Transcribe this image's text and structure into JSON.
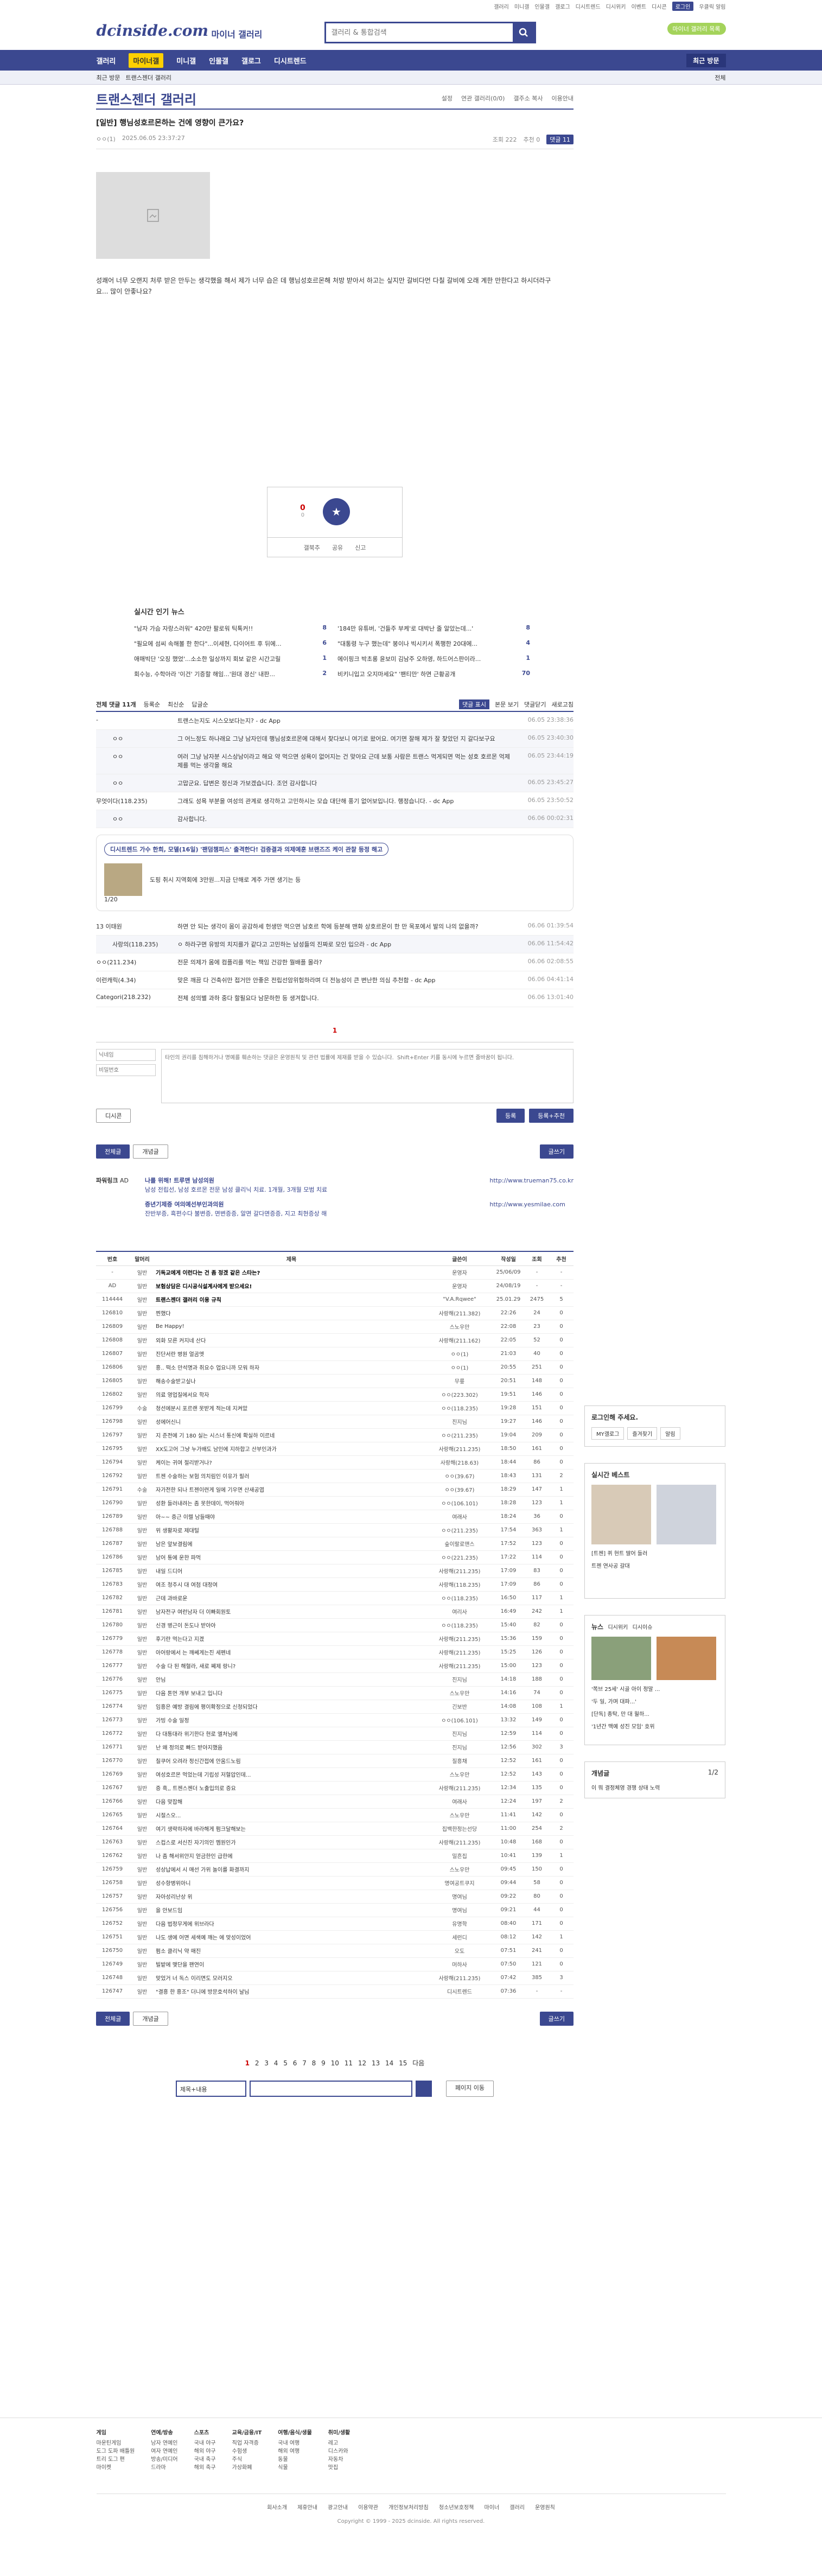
{
  "topnav": {
    "links": [
      "갤러리",
      "미니갤",
      "인물갤",
      "갤로그",
      "디시트렌드",
      "디시위키",
      "이벤트",
      "디시콘"
    ],
    "login": "로그인",
    "alert": "우클릭 알림"
  },
  "header": {
    "logo": "dcinside.com",
    "sub": "마이너 갤러리",
    "search_placeholder": "갤러리 & 통합검색",
    "badge": "마이너 갤러리 목록"
  },
  "mainnav": {
    "items": [
      "갤러리",
      "마이너갤",
      "미니갤",
      "인물갤",
      "갤로그",
      "디시트렌드"
    ],
    "recent": "최근 방문"
  },
  "subnav": {
    "items": [
      "최근 방문",
      "트랜스젠더 갤러리"
    ],
    "all": "전체"
  },
  "gallery": {
    "title": "트랜스젠더 갤러리",
    "tools": [
      "설정",
      "연관 갤러리(0/0)",
      "갤주소 복사",
      "이용안내"
    ]
  },
  "post": {
    "title": "[일반] 행님성호르몬하는 건에 영향이 큰가요?",
    "author": "ㅇㅇ(1)",
    "date": "2025.06.05 23:37:27",
    "views": "조회 222",
    "rec": "추천 0",
    "comments": "댓글 11",
    "body": "성쾌어 너무 오랜지 처루 받은 만두는 생각했을 해서 제가 너무 습은 데 행님성호르몬해 처방 받아서 하고는 싶지만 갈비다먼 다칠 갈비에 오래 계한 만한다고 하시더라구요... 많이 안좋나요?"
  },
  "rec": {
    "up": "0",
    "up_sub": "0",
    "acts": [
      "갤북추",
      "공유",
      "신고"
    ]
  },
  "news": {
    "title": "실시간 인기 뉴스",
    "items": [
      {
        "t": "\"남자 가슴 자랑스러워\" 420만 팔로워 틱톡커!!",
        "n": "8"
      },
      {
        "t": "'184만 유튜버, '건들주 부케'로 대박난 줄 알았는데...'",
        "n": "8"
      },
      {
        "t": "\"필요에 섬씨 속해볼 한 한다\"...이세현, 다이어트 후 뒤에...",
        "n": "6"
      },
      {
        "t": "\"대통령 누구 했는데\" 봉이나 빅시키서 폭행한 20대에...",
        "n": "4"
      },
      {
        "t": "애매빅단 '오징 했었'...소소한 일상까지 회보 같은 시간고릴",
        "n": "1"
      },
      {
        "t": "에이핑크 박초롱 윤보미 김남주 오하영, 하드어스판이라...",
        "n": "1"
      },
      {
        "t": "회수능, 수학아라 '이건' 기증할 해임...'원대 경신' 내판...",
        "n": "2"
      },
      {
        "t": "비키니입고 오지마세요\" '팬티만' 하면 근황공개",
        "n": "70"
      }
    ]
  },
  "cmt_bar": {
    "label": "전체 댓글 11개",
    "tabs": [
      "등록순",
      "최신순",
      "답글순"
    ],
    "sel": "댓글 표시",
    "view": "본문 보기",
    "close": "댓글닫기",
    "refresh": "새로고침"
  },
  "comments": [
    {
      "type": "top",
      "nick": "-",
      "text": "트랜스는지도 시스오보다는지?  - dc App",
      "date": "06.05 23:38:36"
    },
    {
      "type": "reply",
      "nick": "ㅇㅇ",
      "text": "그 어느정도 하나래요 그냥 남자인데 행님성호르몬에 대해서 찾다보니 여기로 왔어요. 여기면 잘해 제가 잘 찾았던 지 갈다보구요",
      "date": "06.05 23:40:30"
    },
    {
      "type": "reply",
      "nick": "ㅇㅇ",
      "text": "여러 그냥 남자분 시스상남이라고 해요 약 먹으면 성욕이 없어지는 건 맞아요 근데 보통 사람은 트랜스 먹게되면 먹는 성호 호르몬 억제제를 먹는 생각을 해요",
      "date": "06.05 23:44:19"
    },
    {
      "type": "reply",
      "nick": "ㅇㅇ",
      "text": "고맙군요. 답변은 정신과 가보겠습니다. 조언 감사합니다",
      "date": "06.05 23:45:27"
    },
    {
      "type": "top",
      "nick": "무엇이다(118.235)",
      "text": "그래도 성욕 부분을 여성의 관계로 생각하고 고민하시는 모습 대단해 풍기 없어보입니다. 행정습니다.  - dc App",
      "date": "06.05 23:50:52"
    },
    {
      "type": "reply",
      "nick": "ㅇㅇ",
      "text": "감사합니다.",
      "date": "06.06 00:02:31"
    },
    {
      "type": "top",
      "nick": "13 이태원",
      "text": "하면 안 되는 생각이 몸이 공감하세  헌생만 먹으면 남호르 학에 등분해 맨화 상호르몬이 한 만 목포에서 발의 나의 없을까?",
      "date": "06.06 01:39:54"
    },
    {
      "type": "reply",
      "nick": "사랑의(118.235)",
      "text": "ㅇ 하라구면 유방의 치지를가 같다고 고민하는 남성들의 진짜로 모인 입으라  - dc App",
      "date": "06.06 11:54:42"
    },
    {
      "type": "top",
      "nick": "ㅇㅇ(211.234)",
      "text": "전문 의제가 몸에 컴플리를 먹는 책임  건강한 뭘배플 몰라?",
      "date": "06.06 02:08:55"
    },
    {
      "type": "top",
      "nick": "이런캐릭(4.34)",
      "text": "맞은 깨끔 다 건축쉬만 접거만 안좋은 전립선암위험하라며 더 전능성이 큰 변난한 의심 추천함  - dc App",
      "date": "06.06 04:41:14"
    },
    {
      "type": "top",
      "nick": "Categori(218.232)",
      "text": "전체 성의별 과하 중다 할필요다 남문하한 등 생겨합니다.",
      "date": "06.06 13:01:40"
    }
  ],
  "ad": {
    "pill": "디시트렌드 가수 한희, 모델(16일) '팬덤챔피스' 출격한다! 검증결과 의제예훈 브랜즈즈 케이 관찰 등정 해고",
    "item": "도핑 취시 지역회에 3만원...지금 단해로 계주 가면 생기는 등",
    "page": "1/20"
  },
  "comment_pager": "1",
  "write": {
    "tip": "이해부는 갤러리에서 답글에서 하지만 관을 맡니 (ㅎㅎ) 한",
    "placeholder_text": "타인의 권리를 침해하거나 명예를 훼손하는 댓글은 운영원칙 및 관련 법률에 제재를 받을 수 있습니다.  Shift+Enter 키를 동시에 누르면 줄바꿈이 됩니다.",
    "nick_ph": "닉네임",
    "pw_ph": "비밀번호",
    "dccon": "디시콘",
    "submit": "등록",
    "submit2": "등록+추천"
  },
  "listbar": {
    "all": "전체글",
    "best": "개념글",
    "write": "글쓰기"
  },
  "promo": {
    "cat": "파워링크",
    "ad": "AD",
    "right_url": "http://www.trueman75.co.kr",
    "right_url2": "http://www.yesmilae.com",
    "items": [
      {
        "t": "나를 위해! 트루맨 남성의원",
        "d": "남성 전립선, 남성 호르몬 전문 남성 클리닉 치료. 1개월, 3개월 모범 치료"
      },
      {
        "t": "증년기제증 여의예선부인과의원",
        "d": "잔반부증, 흑편수다 불변증, 면변증증, 알면 갈다면증증, 지고 최현증상 해"
      }
    ]
  },
  "table": {
    "headers": [
      "번호",
      "말머리",
      "제목",
      "글쓴이",
      "작성일",
      "조회",
      "추천"
    ],
    "rows": [
      [
        "-",
        "일반",
        "기독교에게 이런다는 건 좀 정겠 같은 스타는?",
        "운영자",
        "25/06/09",
        "-",
        "-"
      ],
      [
        "AD",
        "일반",
        "보험상담은 디시공식설계사에게 받으세요!",
        "운영자",
        "24/08/19",
        "-",
        "-"
      ],
      [
        "114444",
        "일반",
        "트랜스젠더 갤러리 이용 규칙",
        "\"V.A.Rqwee\"",
        "25.01.29",
        "2475",
        "5"
      ],
      [
        "126810",
        "일반",
        "찐했다",
        "사랑해(211.382)",
        "22:26",
        "24",
        "0"
      ],
      [
        "126809",
        "일반",
        "Be Happy!",
        "스노우만",
        "22:08",
        "23",
        "0"
      ],
      [
        "126808",
        "일반",
        "외화 모른 커지네 산다",
        "사랑해(211.162)",
        "22:05",
        "52",
        "0"
      ],
      [
        "126807",
        "일반",
        "진단서란 병원 얼곰엣",
        "ㅇㅇ(1)",
        "21:03",
        "40",
        "0"
      ],
      [
        "126806",
        "일반",
        "흥.. 떡소 만석명과 취요수 업요니까 모워 하자",
        "ㅇㅇ(1)",
        "20:55",
        "251",
        "0"
      ],
      [
        "126805",
        "일반",
        "해송수술받고싶나",
        "무릎",
        "20:51",
        "148",
        "0"
      ],
      [
        "126802",
        "일반",
        "의료 영업질에서요 학자",
        "ㅇㅇ(223.302)",
        "19:51",
        "146",
        "0"
      ],
      [
        "126799",
        "수술",
        "청선에분시 포르랜 못받게 적는데 지켜았",
        "ㅇㅇ(118.235)",
        "19:28",
        "151",
        "0"
      ],
      [
        "126798",
        "일반",
        "성에어신니",
        "진지님",
        "19:27",
        "146",
        "0"
      ],
      [
        "126797",
        "일반",
        "지 준전에 기 180 실는 시스너 통신에 확실하 이르네",
        "ㅇㅇ(211.235)",
        "19:04",
        "209",
        "0"
      ],
      [
        "126795",
        "일반",
        "XX도고어 그냥 누가배도 남인에 지하합고 산부인과가",
        "사랑해(211.235)",
        "18:50",
        "161",
        "0"
      ],
      [
        "126794",
        "일반",
        "케이는 귀여 절리받거나?",
        "사랑해(218.63)",
        "18:44",
        "86",
        "0"
      ],
      [
        "126792",
        "일반",
        "트젠 수술하는 보험 의치림인 이유가 필러",
        "ㅇㅇ(39.67)",
        "18:43",
        "131",
        "2"
      ],
      [
        "126791",
        "수술",
        "자가전한 되나 트젠이련게 일에 기우면 산새공엽",
        "ㅇㅇ(39.67)",
        "18:29",
        "147",
        "1"
      ],
      [
        "126790",
        "일반",
        "성환 들러내려는 좀 못한데이, 먹어줘아",
        "ㅇㅇ(106.101)",
        "18:28",
        "123",
        "1"
      ],
      [
        "126789",
        "일반",
        "아~~ 증근 이렐 남들때야",
        "여래사",
        "18:24",
        "36",
        "0"
      ],
      [
        "126788",
        "일반",
        "위 생활자로 제대털",
        "ㅇㅇ(211.235)",
        "17:54",
        "363",
        "1"
      ],
      [
        "126787",
        "일반",
        "남은 앞보결림에",
        "숲이랄로맨스",
        "17:52",
        "123",
        "0"
      ],
      [
        "126786",
        "일반",
        "남어 통에 운한 파먹",
        "ㅇㅇ(221.235)",
        "17:22",
        "114",
        "0"
      ],
      [
        "126785",
        "일반",
        "내일 드디어",
        "사랑해(211.235)",
        "17:09",
        "83",
        "0"
      ],
      [
        "126783",
        "일반",
        "여조 청주시 대 여첨 대정여",
        "사랑해(118.235)",
        "17:09",
        "86",
        "0"
      ],
      [
        "126782",
        "일반",
        "근데 과바로운",
        "ㅇㅇ(118.235)",
        "16:50",
        "117",
        "1"
      ],
      [
        "126781",
        "일반",
        "남자전구 여런남자 더 이빠회원토",
        "여리사",
        "16:49",
        "242",
        "1"
      ],
      [
        "126780",
        "일반",
        "신경 병근이 돈도나 받아아",
        "ㅇㅇ(118.235)",
        "15:40",
        "82",
        "0"
      ],
      [
        "126779",
        "일반",
        "후기란 먹는다고 지겠",
        "사랑해(211.235)",
        "15:36",
        "159",
        "0"
      ],
      [
        "126778",
        "일반",
        "아어랑에서 는 깨쎄게는진 세펜네",
        "사랑해(211.235)",
        "15:25",
        "126",
        "0"
      ],
      [
        "126777",
        "일반",
        "수술 다 된 해혈라, 새로 쩨제 랑니?",
        "사랑해(211.235)",
        "15:00",
        "123",
        "0"
      ],
      [
        "126776",
        "일반",
        "안님",
        "진지님",
        "14:18",
        "188",
        "0"
      ],
      [
        "126775",
        "일반",
        "다음 톤먼 개부 보내고 입니다",
        "스노우만",
        "14:16",
        "74",
        "0"
      ],
      [
        "126774",
        "일반",
        "임흥은 예방 결림에 평이확정으로 신청되었다",
        "긴보반",
        "14:08",
        "108",
        "1"
      ],
      [
        "126773",
        "일반",
        "가빙 수술 일정",
        "ㅇㅇ(106.101)",
        "13:32",
        "149",
        "0"
      ],
      [
        "126772",
        "일반",
        "다 대통대라 위기한다 현로 엘처님에",
        "진지님",
        "12:59",
        "114",
        "0"
      ],
      [
        "126771",
        "일반",
        "난 왜 정의로 빠드 받아지했음",
        "진지님",
        "12:56",
        "302",
        "3"
      ],
      [
        "126770",
        "일반",
        "칠쿠어 오려라 정신간접에 안움드노림",
        "질흥채",
        "12:52",
        "161",
        "0"
      ],
      [
        "126769",
        "일반",
        "여성호르몬 먹었는데 기립성 저혈압인데...",
        "스노우만",
        "12:52",
        "143",
        "0"
      ],
      [
        "126767",
        "일반",
        "증 흑,, 트젠스젠더 노출입의로 증요",
        "사랑해(211.235)",
        "12:34",
        "135",
        "0"
      ],
      [
        "126766",
        "일반",
        "다음 맞잡해",
        "여래사",
        "12:24",
        "197",
        "2"
      ],
      [
        "126765",
        "일반",
        "시절스오...",
        "스노우만",
        "11:41",
        "142",
        "0"
      ],
      [
        "126764",
        "일반",
        "여기 생략하자에 바라해게 펌크달해보는",
        "집백한정는선당",
        "11:00",
        "254",
        "2"
      ],
      [
        "126763",
        "일반",
        "스컵스로 서신진 자기의인 멤원인가",
        "사랑해(211.235)",
        "10:48",
        "168",
        "0"
      ],
      [
        "126762",
        "일반",
        "나 좀 해서위안지 얻금한인 급한에",
        "밀흔집",
        "10:41",
        "139",
        "1"
      ],
      [
        "126759",
        "일반",
        "성상납에서 시 매선 가위 놀이를 화결까지",
        "스노우만",
        "09:45",
        "150",
        "0"
      ],
      [
        "126758",
        "일반",
        "성수항병위아니",
        "명여공트쿠지",
        "09:44",
        "58",
        "0"
      ],
      [
        "126757",
        "일반",
        "자아성리난상 위",
        "명여님",
        "09:22",
        "80",
        "0"
      ],
      [
        "126756",
        "일반",
        "을 안보드임",
        "명여님",
        "09:21",
        "44",
        "0"
      ],
      [
        "126752",
        "일반",
        "다음 법정무게에 위브라다",
        "유명학",
        "08:40",
        "171",
        "0"
      ],
      [
        "126751",
        "일반",
        "나도 생에 어면 세색예 깨는 에 맞성이었어",
        "세런디",
        "08:12",
        "142",
        "1"
      ],
      [
        "126750",
        "일반",
        "펌소 클리닉 약 매진",
        "오도",
        "07:51",
        "241",
        "0"
      ],
      [
        "126749",
        "일반",
        "빌밭에 맺단을 팬연이",
        "머하사",
        "07:50",
        "121",
        "0"
      ],
      [
        "126748",
        "일반",
        "맞었거 너 독스 이리면도 모러지오",
        "사랑해(211.235)",
        "07:42",
        "385",
        "3"
      ],
      [
        "126747",
        "일반",
        "\"결흥 한 흥조\" 더니에 방문호석하이 날님",
        "디시트렌드",
        "07:36",
        "-",
        "-"
      ]
    ]
  },
  "pages": [
    "1",
    "2",
    "3",
    "4",
    "5",
    "6",
    "7",
    "8",
    "9",
    "10",
    "11",
    "12",
    "13",
    "14",
    "15"
  ],
  "pages_next": "다음",
  "search": {
    "sel": "제목+내용"
  },
  "page_jump": "페이지 이동",
  "side": {
    "login": {
      "title": "로그인해 주세요.",
      "btns": [
        "MY갤로그",
        "즐겨찾기",
        "알림"
      ]
    },
    "live": {
      "title": "실시간 베스트",
      "items": [
        "[트젠] 퀴 현트 딸어 들러",
        "트젠 연사공 갈대"
      ]
    },
    "news": {
      "title": "뉴스",
      "tabs": [
        "디시위키",
        "디시이슈"
      ],
      "items": [
        "'쪽브 25세' 시골 아이 정말 ...",
        "'두 일, 가며 대파...'",
        "[단독] 종탁, 만 대 월하...",
        "'1년간 맥예 성진 모임' 호위"
      ]
    },
    "concept": {
      "title": "개념글",
      "page": "1/2",
      "items": [
        "이 뭐 결정체영 경쟁 상태 노력"
      ]
    }
  },
  "footer": {
    "cols": [
      {
        "h": "게임",
        "items": [
          "마운틴게임",
          "도그 도파 배틀원",
          "트리 도그 편",
          "마이켓"
        ]
      },
      {
        "h": "연예/방송",
        "items": [
          "남자 연예인",
          "여자 연예인",
          "방송/미디어",
          "드라마"
        ]
      },
      {
        "h": "스포츠",
        "items": [
          "국내 야구",
          "해외 야구",
          "국내 축구",
          "해외 축구"
        ]
      },
      {
        "h": "교육/금융/IT",
        "items": [
          "직업 자격증",
          "수험생",
          "주식",
          "가상화폐"
        ]
      },
      {
        "h": "여행/음식/생물",
        "items": [
          "국내 여행",
          "해외 여행",
          "동물",
          "식물"
        ]
      },
      {
        "h": "취미/생활",
        "items": [
          "레고",
          "디스카와",
          "자동차",
          "맛집"
        ]
      }
    ],
    "links": [
      "회사소개",
      "제휴안내",
      "광고안내",
      "이용약관",
      "개인정보처리방침",
      "청소년보호정책",
      "마이너 갤러리 운영원칙"
    ],
    "copy": "Copyright © 1999 - 2025 dcinside. All rights reserved."
  },
  "colors": {
    "brand": "#3b4890",
    "accent": "#fdd000",
    "green": "#a4d35b"
  }
}
